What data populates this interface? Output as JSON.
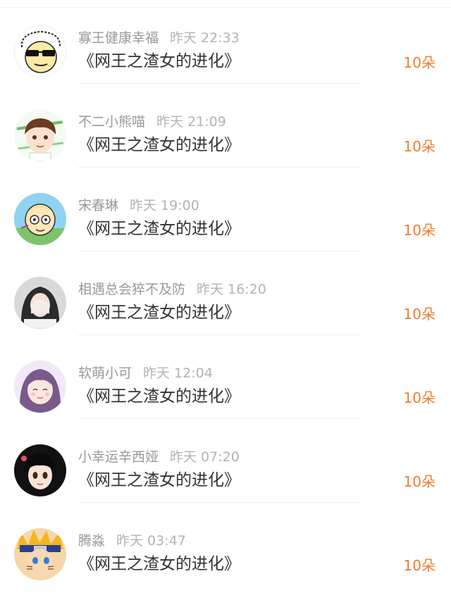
{
  "items": [
    {
      "name": "寡王健康幸福",
      "time": "昨天 22:33",
      "title": "《网王之渣女的进化》",
      "amount": "10朵",
      "avatar": "cartoon-sunglasses-avatar"
    },
    {
      "name": "不二小熊喵",
      "time": "昨天 21:09",
      "title": "《网王之渣女的进化》",
      "amount": "10朵",
      "avatar": "anime-boy-avatar"
    },
    {
      "name": "宋春琳",
      "time": "昨天 19:00",
      "title": "《网王之渣女的进化》",
      "amount": "10朵",
      "avatar": "cartoon-glasses-avatar"
    },
    {
      "name": "相遇总会猝不及防",
      "time": "昨天 16:20",
      "title": "《网王之渣女的进化》",
      "amount": "10朵",
      "avatar": "girl-photo-avatar"
    },
    {
      "name": "软萌小可",
      "time": "昨天 12:04",
      "title": "《网王之渣女的进化》",
      "amount": "10朵",
      "avatar": "anime-girl-purple-avatar"
    },
    {
      "name": "小幸运辛西娅",
      "time": "昨天 07:20",
      "title": "《网王之渣女的进化》",
      "amount": "10朵",
      "avatar": "anime-girl-dark-avatar"
    },
    {
      "name": "腾淼",
      "time": "昨天 03:47",
      "title": "《网王之渣女的进化》",
      "amount": "10朵",
      "avatar": "naruto-avatar"
    }
  ],
  "colors": {
    "accent": "#f07c2a",
    "name": "#999999",
    "time": "#b3b3b3",
    "title": "#333333"
  }
}
